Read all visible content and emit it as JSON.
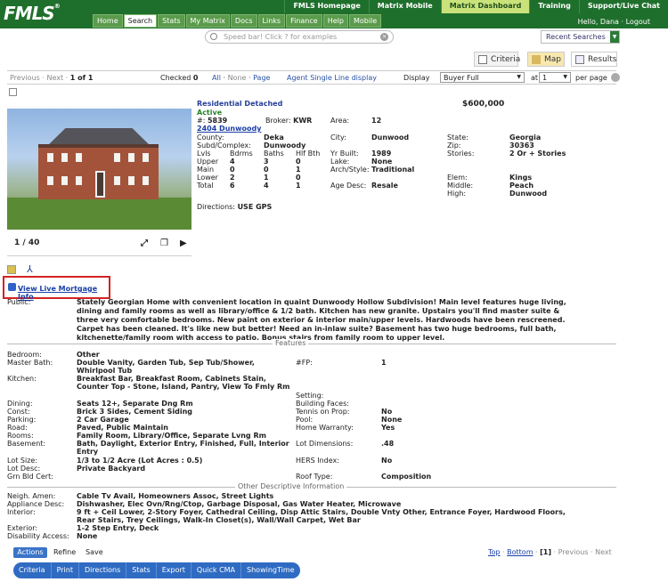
{
  "header": {
    "logo": "FMLS",
    "logo_mark": "®",
    "top_links": [
      "FMLS Homepage",
      "Matrix Mobile",
      "Matrix Dashboard",
      "Training",
      "Support/Live Chat"
    ],
    "active_top_link": "Matrix Dashboard",
    "tabs": [
      "Home",
      "Search",
      "Stats",
      "My Matrix",
      "Docs",
      "Links",
      "Finance",
      "Help",
      "Mobile"
    ],
    "selected_tab": "Search",
    "greeting": "Hello, Dana",
    "logout": "Logout"
  },
  "speedbar": {
    "placeholder": "Speed bar!  Click ? for examples"
  },
  "recent_searches": "Recent Searches",
  "view_tabs": {
    "criteria": "Criteria",
    "map": "Map",
    "results": "Results"
  },
  "results_bar": {
    "previous": "Previous",
    "next": "Next",
    "page_of": "1 of 1",
    "checked_label": "Checked",
    "checked_count": "0",
    "all": "All",
    "none": "None",
    "page": "Page",
    "agent_view": "Agent Single Line display",
    "display_label": "Display",
    "display_value": "Buyer Full",
    "at_label": "at",
    "per_page_value": "1",
    "per_page_label": "per page"
  },
  "listing": {
    "type": "Residential Detached",
    "price": "$600,000",
    "status": "Active",
    "mls_label": "#:",
    "mls_no": "5839",
    "broker_label": "Broker:",
    "broker": "KWR",
    "area_label": "Area:",
    "area": "12",
    "address": "2404 Dunwoody",
    "county_label": "County:",
    "county": "Deka",
    "city_label": "City:",
    "city": "Dunwood",
    "state_label": "State:",
    "state": "Georgia",
    "subd_label": "Subd/Complex:",
    "subd": "Dunwoody",
    "yr_label": "Yr Built:",
    "yr": "1989",
    "zip_label": "Zip:",
    "zip": "30363",
    "stories_label": "Stories:",
    "stories": "2 Or + Stories",
    "lvls_header": [
      "Lvls",
      "Bdrms",
      "Baths",
      "Hlf Bth"
    ],
    "lvls_rows": [
      [
        "Upper",
        "4",
        "3",
        "0"
      ],
      [
        "Main",
        "0",
        "0",
        "1"
      ],
      [
        "Lower",
        "2",
        "1",
        "0"
      ],
      [
        "Total",
        "6",
        "4",
        "1"
      ]
    ],
    "lake_label": "Lake:",
    "lake": "None",
    "arch_label": "Arch/Style:",
    "arch": "Traditional",
    "age_label": "Age Desc:",
    "age": "Resale",
    "elem_label": "Elem:",
    "elem": "Kings",
    "middle_label": "Middle:",
    "middle": "Peach",
    "high_label": "High:",
    "high": "Dunwood",
    "directions_label": "Directions:",
    "directions": "USE GPS",
    "photo_counter": "1 / 40",
    "mortgage_link": "View Live Mortgage Info",
    "public_label": "Public:",
    "public_remarks": "Stately Georgian Home with convenient location in quaint Dunwoody Hollow Subdivision! Main level features huge living, dining and family rooms as well as library/office & 1/2 bath. Kitchen has new granite. Upstairs you'll find master suite & three very comfortable bedrooms. New paint on exterior & interior main/upper levels. Hardwoods have been rescreened. Carpet has been cleaned. It's like new but better! Need an in-inlaw suite? Basement has two huge bedrooms, full bath, kitchenette/family room with access to patio. Bonus stairs from family room to upper level."
  },
  "features_title": "Features",
  "features_left": [
    {
      "label": "Bedroom:",
      "value": "Other"
    },
    {
      "label": "Master Bath:",
      "value": "Double Vanity, Garden Tub, Sep Tub/Shower, Whirlpool Tub"
    },
    {
      "label": "Kitchen:",
      "value": "Breakfast Bar, Breakfast Room, Cabinets Stain, Counter Top - Stone, Island, Pantry, View To Fmly Rm"
    },
    {
      "label": "Dining:",
      "value": "Seats 12+, Separate Dng Rm"
    },
    {
      "label": "Const:",
      "value": "Brick 3 Sides, Cement Siding"
    },
    {
      "label": "Parking:",
      "value": "2 Car Garage"
    },
    {
      "label": "Road:",
      "value": "Paved, Public Maintain"
    },
    {
      "label": "Rooms:",
      "value": "Family Room, Library/Office, Separate Lvng Rm"
    },
    {
      "label": "Basement:",
      "value": "Bath, Daylight, Exterior Entry, Finished, Full, Interior Entry"
    },
    {
      "label": "Lot Size:",
      "value": "1/3 to 1/2 Acre (Lot Acres : 0.5)"
    },
    {
      "label": "Lot Desc:",
      "value": "Private Backyard"
    },
    {
      "label": "Grn Bld Cert:",
      "value": ""
    }
  ],
  "features_right": [
    {
      "label": "#FP:",
      "value": "1"
    },
    {
      "label": "Setting:",
      "value": ""
    },
    {
      "label": "Building Faces:",
      "value": ""
    },
    {
      "label": "Tennis on Prop:",
      "value": "No"
    },
    {
      "label": "Pool:",
      "value": "None"
    },
    {
      "label": "Home Warranty:",
      "value": "Yes"
    },
    {
      "label": "Lot Dimensions:",
      "value": ".48"
    },
    {
      "label": "HERS Index:",
      "value": "No"
    },
    {
      "label": "Roof Type:",
      "value": "Composition"
    }
  ],
  "other_title": "Other Descriptive Information",
  "other": [
    {
      "label": "Neigh. Amen:",
      "value": "Cable Tv Avail, Homeowners Assoc, Street Lights"
    },
    {
      "label": "Appliance Desc:",
      "value": "Dishwasher, Elec Ovn/Rng/Ctop, Garbage Disposal, Gas Water Heater, Microwave"
    },
    {
      "label": "Interior:",
      "value": "9 ft + Ceil Lower, 2-Story Foyer, Cathedral Ceiling, Disp Attic Stairs, Double Vnty Other, Entrance Foyer, Hardwood Floors, Rear Stairs, Trey Ceilings, Walk-In Closet(s), Wall/Wall Carpet, Wet Bar"
    },
    {
      "label": "Exterior:",
      "value": "1-2 Step Entry, Deck"
    },
    {
      "label": "Disability Access:",
      "value": "None"
    }
  ],
  "footer": {
    "actions": "Actions",
    "refine": "Refine",
    "save": "Save",
    "top": "Top",
    "bottom": "Bottom",
    "current_page": "[1]",
    "previous": "Previous",
    "next": "Next",
    "buttons": [
      "Criteria",
      "Print",
      "Directions",
      "Stats",
      "Export",
      "Quick CMA",
      "ShowingTime"
    ]
  }
}
